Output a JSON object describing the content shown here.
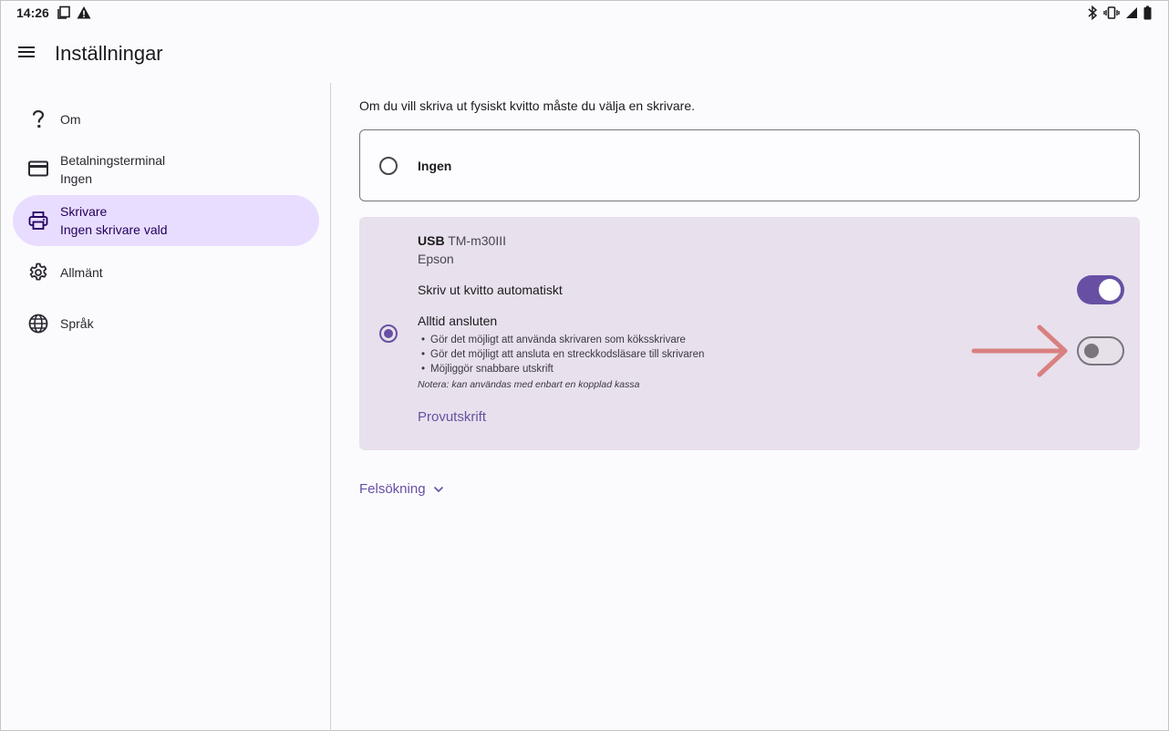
{
  "status_bar": {
    "time": "14:26",
    "left_icons": [
      "screenshot-icon",
      "warning-icon"
    ],
    "right_icons": [
      "bluetooth-icon",
      "vibrate-icon",
      "signal-icon",
      "battery-icon"
    ]
  },
  "app_bar": {
    "title": "Inställningar",
    "menu_icon": "menu-icon"
  },
  "sidebar": {
    "items": [
      {
        "icon": "help-icon",
        "label": "Om",
        "sub": ""
      },
      {
        "icon": "credit-card-icon",
        "label": "Betalningsterminal",
        "sub": "Ingen"
      },
      {
        "icon": "printer-icon",
        "label": "Skrivare",
        "sub": "Ingen skrivare vald",
        "active": true
      },
      {
        "icon": "gear-icon",
        "label": "Allmänt",
        "sub": ""
      },
      {
        "icon": "globe-icon",
        "label": "Språk",
        "sub": ""
      }
    ]
  },
  "content": {
    "intro": "Om du vill skriva ut fysiskt kvitto måste du välja en skrivare.",
    "none_option": {
      "label": "Ingen",
      "selected": false
    },
    "printer_option": {
      "connection": "USB",
      "model": "TM-m30III",
      "maker": "Epson",
      "selected": true,
      "auto_print_label": "Skriv ut kvitto automatiskt",
      "auto_print_on": true,
      "always_connected_label": "Alltid ansluten",
      "always_connected_on": false,
      "bullets": [
        "Gör det möjligt att använda skrivaren som köksskrivare",
        "Gör det möjligt att ansluta en streckkodsläsare till skrivaren",
        "Möjliggör snabbare utskrift"
      ],
      "note": "Notera: kan användas med enbart en kopplad kassa",
      "test_print_label": "Provutskrift"
    },
    "troubleshooting_label": "Felsökning"
  },
  "colors": {
    "accent": "#6750a4",
    "active_nav_bg": "#e9ddff",
    "card_bg": "#e8e0ec",
    "annotation_arrow": "#d98080"
  }
}
